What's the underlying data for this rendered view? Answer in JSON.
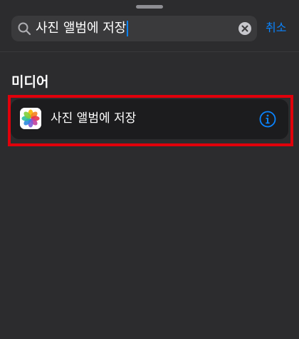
{
  "search": {
    "query": "사진 앨범에 저장",
    "icon": "magnifying-glass-icon",
    "clear_icon": "clear-x-circle-icon"
  },
  "cancel_label": "취소",
  "section": {
    "title": "미디어"
  },
  "result": {
    "label": "사진 앨범에 저장",
    "app_icon": "photos-app-icon",
    "info_icon": "info-circle-icon"
  },
  "colors": {
    "background": "#2c2c2e",
    "search_field": "#3a3a3c",
    "row_background": "#1c1c1e",
    "accent": "#0a84ff",
    "highlight": "#e0000b"
  }
}
